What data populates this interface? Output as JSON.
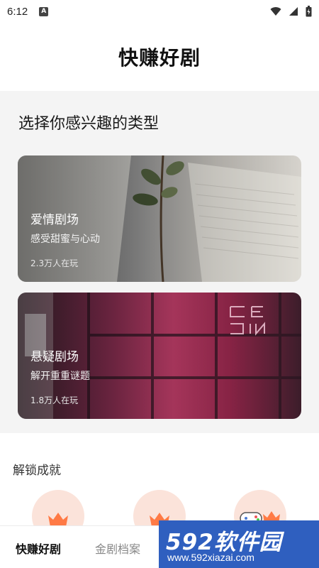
{
  "status_bar": {
    "time": "6:12",
    "notification_badge": "A"
  },
  "header": {
    "title": "快赚好剧"
  },
  "category_section": {
    "heading": "选择你感兴趣的类型",
    "cards": [
      {
        "title": "爱情剧场",
        "subtitle": "感受甜蜜与心动",
        "players": "2.3万人在玩"
      },
      {
        "title": "悬疑剧场",
        "subtitle": "解开重重谜题",
        "players": "1.8万人在玩"
      }
    ]
  },
  "achievements": {
    "heading": "解锁成就",
    "badge_icons": [
      "crown-icon",
      "crown-icon",
      "gamepad-crown-icon"
    ]
  },
  "bottom_nav": {
    "tabs": [
      {
        "label": "快赚好剧",
        "active": true
      },
      {
        "label": "金剧档案",
        "active": false
      }
    ]
  },
  "watermark": {
    "logo": "592软件园",
    "url": "www.592xiazai.com"
  },
  "colors": {
    "accent_crown": "#ff7a45",
    "badge_bg": "#fbe3da",
    "section_bg": "#f4f4f4",
    "watermark_bg": "#2f5fbf"
  }
}
